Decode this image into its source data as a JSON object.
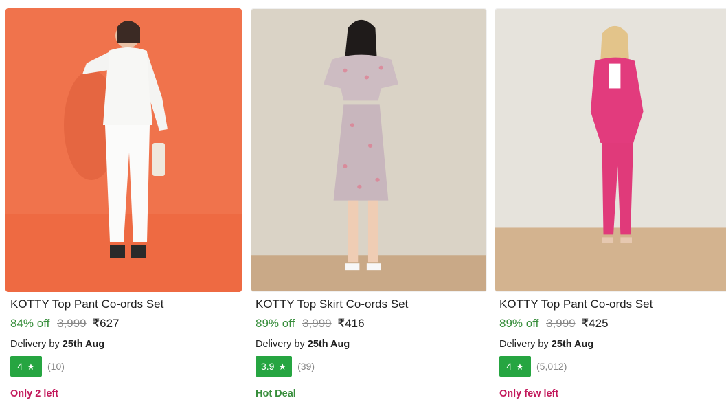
{
  "products": [
    {
      "title": "KOTTY Top Pant Co-ords Set",
      "discount": "84% off",
      "mrp": "3,999",
      "price": "₹627",
      "delivery_prefix": "Delivery by",
      "delivery_date": "25th Aug",
      "rating": "4",
      "rating_count": "(10)",
      "stock": "Only 2 left",
      "stock_color": "#c2185b",
      "image_bg": "#f0734c",
      "image_icon": "product-photo-white-coords"
    },
    {
      "title": "KOTTY Top Skirt Co-ords Set",
      "discount": "89% off",
      "mrp": "3,999",
      "price": "₹416",
      "delivery_prefix": "Delivery by",
      "delivery_date": "25th Aug",
      "rating": "3.9",
      "rating_count": "(39)",
      "stock": "Hot Deal",
      "stock_color": "#388e3c",
      "image_bg": "#d9d2c5",
      "image_icon": "product-photo-floral-coords"
    },
    {
      "title": "KOTTY Top Pant Co-ords Set",
      "discount": "89% off",
      "mrp": "3,999",
      "price": "₹425",
      "delivery_prefix": "Delivery by",
      "delivery_date": "25th Aug",
      "rating": "4",
      "rating_count": "(5,012)",
      "stock": "Only few left",
      "stock_color": "#c2185b",
      "image_bg": "#e4e1da",
      "image_icon": "product-photo-pink-coords"
    }
  ],
  "colors": {
    "discount": "#388e3c",
    "rating_badge": "#26a541",
    "muted": "#878787",
    "text": "#212121"
  }
}
